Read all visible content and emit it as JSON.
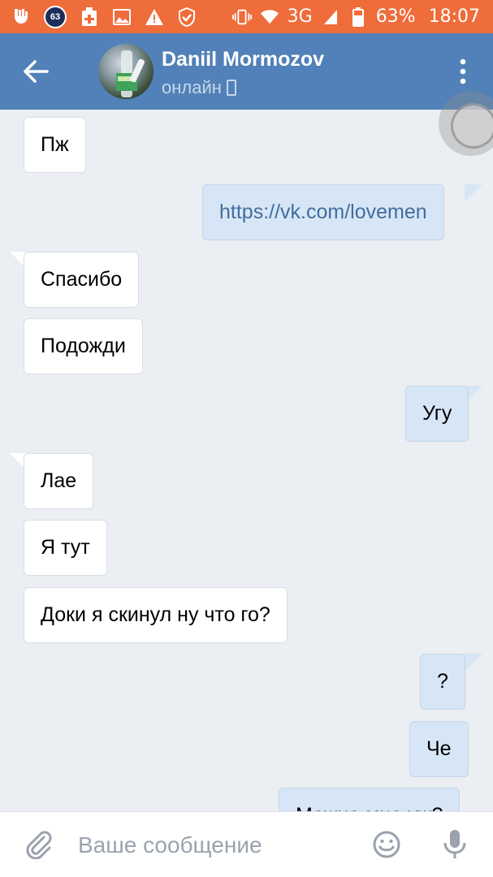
{
  "statusbar": {
    "badge": "63",
    "network": "3G",
    "battery": "63%",
    "time": "18:07"
  },
  "header": {
    "name": "Daniil Mormozov",
    "status": "онлайн"
  },
  "messages": [
    {
      "dir": "in",
      "text": "Пж"
    },
    {
      "dir": "out",
      "text": "https://vk.com/lovemen",
      "link": true
    },
    {
      "dir": "in",
      "text": "Спасибо"
    },
    {
      "dir": "in",
      "text": "Подожди"
    },
    {
      "dir": "out",
      "text": "Угу"
    },
    {
      "dir": "in",
      "text": "Лае"
    },
    {
      "dir": "in",
      "text": "Я тут"
    },
    {
      "dir": "in",
      "text": "Доки я скинул ну что го?"
    },
    {
      "dir": "out",
      "text": "?"
    },
    {
      "dir": "out",
      "text": "Че"
    },
    {
      "dir": "out",
      "text": "Можно мне уж?"
    }
  ],
  "composer": {
    "placeholder": "Ваше сообщение"
  },
  "colors": {
    "statusbar": "#ef6c3b",
    "header": "#5181b8",
    "background": "#ebeef2",
    "bubble_in": "#ffffff",
    "bubble_out": "#d7e6f6",
    "link": "#416e9e"
  }
}
